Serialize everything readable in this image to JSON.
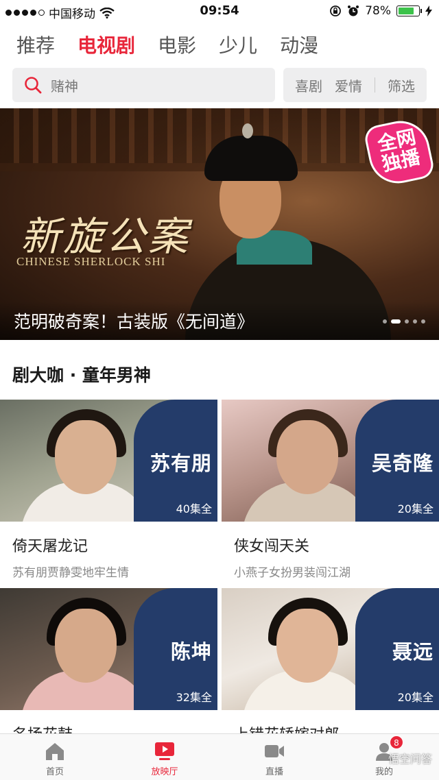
{
  "status_bar": {
    "carrier": "中国移动",
    "time": "09:54",
    "battery": "78%",
    "battery_level": 0.78
  },
  "tabs": [
    {
      "label": "推荐",
      "active": false
    },
    {
      "label": "电视剧",
      "active": true
    },
    {
      "label": "电影",
      "active": false
    },
    {
      "label": "少儿",
      "active": false
    },
    {
      "label": "动漫",
      "active": false
    }
  ],
  "search": {
    "placeholder": "赌神"
  },
  "filters": {
    "item1": "喜剧",
    "item2": "爱情",
    "item3": "筛选"
  },
  "banner": {
    "title_cn": "新旋公案",
    "title_en": "CHINESE SHERLOCK SHI",
    "badge_line1": "全网",
    "badge_line2": "独播",
    "caption": "范明破奇案！古装版《无间道》",
    "slides": 5,
    "active_slide": 1
  },
  "section": {
    "title": "剧大咖 · 童年男神"
  },
  "cards": [
    {
      "name": "苏有朋",
      "episodes": "40集全",
      "title": "倚天屠龙记",
      "subtitle": "苏有朋贾静雯地牢生情"
    },
    {
      "name": "吴奇隆",
      "episodes": "20集全",
      "title": "侠女闯天关",
      "subtitle": "小燕子女扮男装闯江湖"
    },
    {
      "name": "陈坤",
      "episodes": "32集全",
      "title": "名扬花鼓",
      "subtitle": ""
    },
    {
      "name": "聂远",
      "episodes": "20集全",
      "title": "上错花轿嫁对郎",
      "subtitle": ""
    }
  ],
  "tab_bar": {
    "home": "首页",
    "cinema": "放映厅",
    "live": "直播",
    "mine": "我的",
    "mine_badge": "8"
  },
  "watermark": "悟空问答",
  "colors": {
    "accent": "#e8263a",
    "panel_blue": "#243c6a",
    "badge_pink": "#ee2c7b"
  }
}
